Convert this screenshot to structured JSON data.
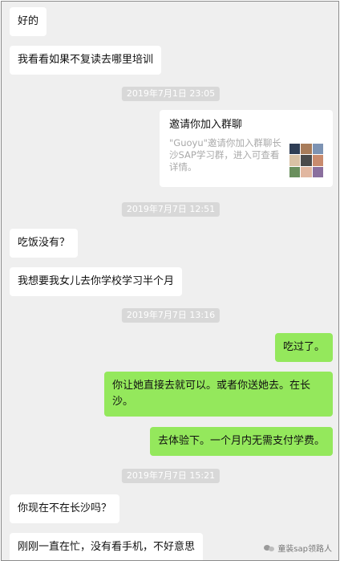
{
  "messages": {
    "m1": "好的",
    "m2": "我看看如果不复读去哪里培训",
    "m3": "吃饭没有？",
    "m4": "我想要我女儿去你学校学习半个月",
    "m5": "吃过了。",
    "m6": "你让她直接去就可以。或者你送她去。在长沙。",
    "m7": "去体验下。一个月内无需支付学费。",
    "m8": "你现在不在长沙吗？",
    "m9": "刚刚一直在忙，没有看手机，不好意思"
  },
  "timestamps": {
    "t1": "2019年7月1日 23:05",
    "t2": "2019年7月7日 12:51",
    "t3": "2019年7月7日 13:16",
    "t4": "2019年7月7日 15:21"
  },
  "invite_card": {
    "title": "邀请你加入群聊",
    "description": "\"Guoyu\"邀请你加入群聊长沙SAP学习群，进入可查看详情。",
    "avatar_colors": [
      "#2f3e55",
      "#a87c5a",
      "#7d93b3",
      "#d9c2a5",
      "#4b4b4b",
      "#c98b6e",
      "#6a8f5d",
      "#e1b7a0",
      "#8a6f9e"
    ]
  },
  "watermark": {
    "text": "童装sap领路人",
    "icon": "wechat-icon"
  },
  "colors": {
    "outgoing_bubble": "#94e85c",
    "incoming_bubble": "#ffffff",
    "background": "#efefef"
  }
}
